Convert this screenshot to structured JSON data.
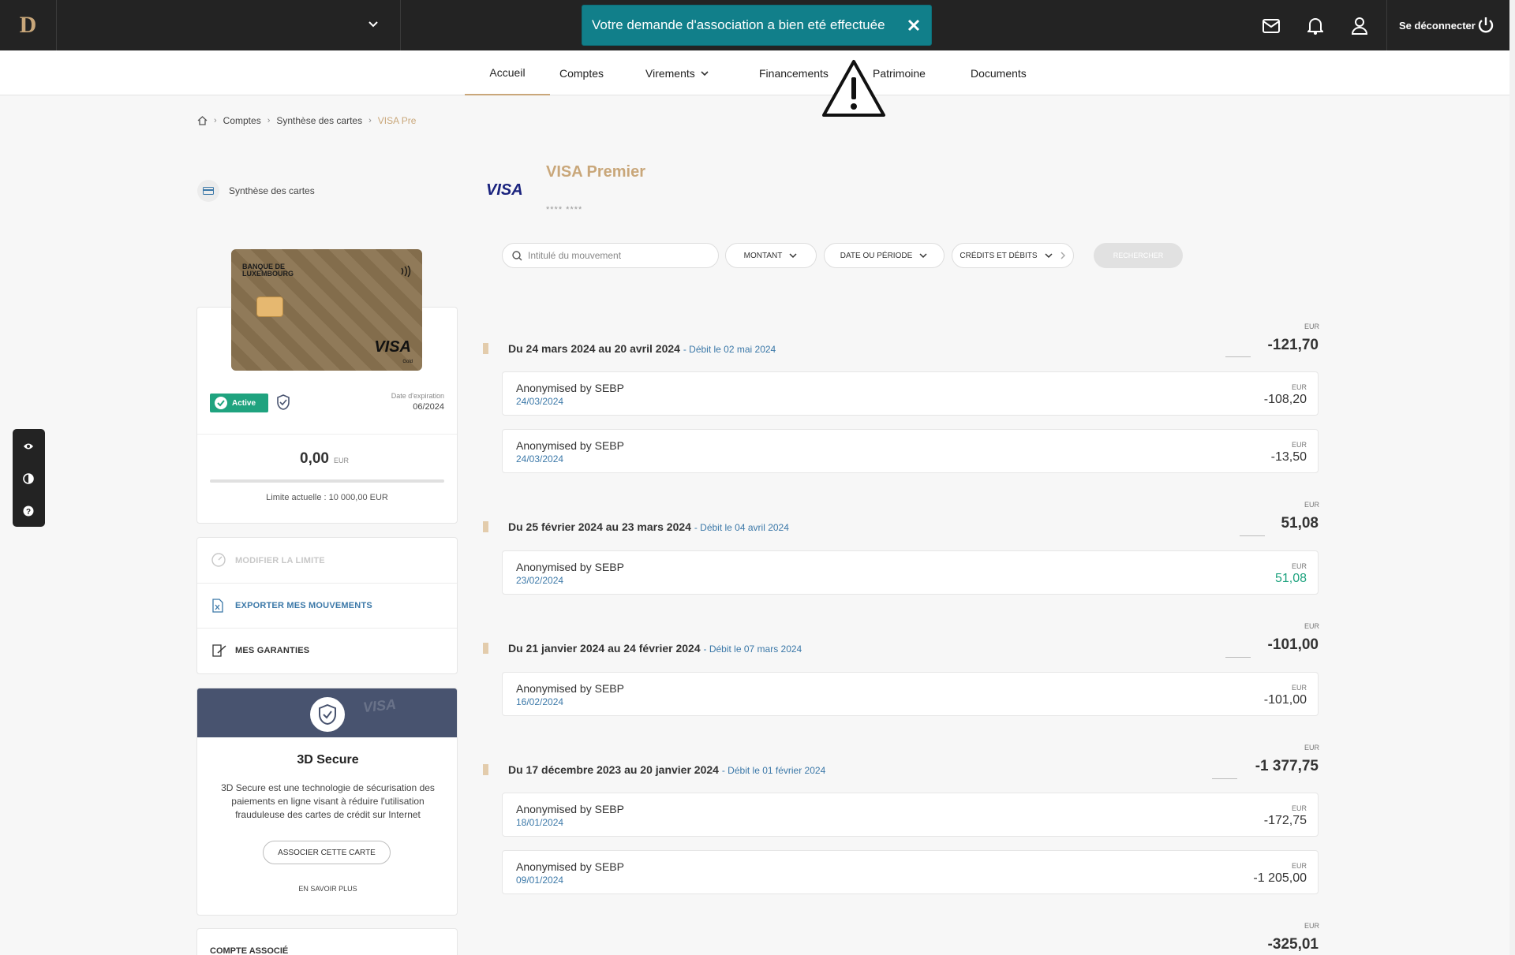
{
  "topbar": {
    "logo": "D",
    "toast": "Votre demande d'association a bien eté effectuée",
    "logout": "Se déconnecter"
  },
  "nav": [
    "Accueil",
    "Comptes",
    "Virements",
    "Financements",
    "Patrimoine",
    "Documents"
  ],
  "breadcrumb": [
    "Comptes",
    "Synthèse des cartes",
    "VISA Pre"
  ],
  "left": {
    "synthese": "Synthèse des cartes",
    "card": {
      "bank": "BANQUE DE LUXEMBOURG",
      "brand": "VISA",
      "tier": "Gold",
      "status": "Active",
      "expiry_label": "Date d'expiration",
      "expiry": "06/2024",
      "balance": "0,00",
      "currency": "EUR",
      "usage_fraction": 0,
      "limit": "Limite actuelle : 10 000,00 EUR"
    },
    "actions": [
      "MODIFIER LA LIMITE",
      "EXPORTER MES MOUVEMENTS",
      "MES GARANTIES"
    ],
    "secure": {
      "band_text": "VISA",
      "title": "3D Secure",
      "desc": "3D Secure est une technologie de sécurisation des paiements en ligne visant à réduire l'utilisation frauduleuse des cartes de crédit sur Internet",
      "assoc": "ASSOCIER CETTE CARTE",
      "more": "EN SAVOIR PLUS"
    },
    "linked_account": "COMPTE ASSOCIÉ"
  },
  "main": {
    "brand": "VISA",
    "title": "VISA Premier",
    "mask": "**** ****",
    "search_placeholder": "Intitulé du mouvement",
    "filters": [
      "MONTANT",
      "DATE OU PÉRIODE",
      "CRÉDITS ET DÉBITS"
    ],
    "search_button": "RECHERCHER",
    "periods": [
      {
        "label": "Du 24 mars 2024 au 20 avril 2024",
        "debit": "- Débit le 02 mai 2024",
        "currency": "EUR",
        "total": "-121,70",
        "transactions": [
          {
            "name": "Anonymised by SEBP",
            "date": "24/03/2024",
            "currency": "EUR",
            "amount": "-108,20"
          },
          {
            "name": "Anonymised by SEBP",
            "date": "24/03/2024",
            "currency": "EUR",
            "amount": "-13,50"
          }
        ]
      },
      {
        "label": "Du 25 février 2024 au 23 mars 2024",
        "debit": "- Débit le 04 avril 2024",
        "currency": "EUR",
        "total": "51,08",
        "transactions": [
          {
            "name": "Anonymised by SEBP",
            "date": "23/02/2024",
            "currency": "EUR",
            "amount": "51,08",
            "positive": true
          }
        ]
      },
      {
        "label": "Du 21 janvier 2024 au 24 février 2024",
        "debit": "- Débit le 07 mars 2024",
        "currency": "EUR",
        "total": "-101,00",
        "transactions": [
          {
            "name": "Anonymised by SEBP",
            "date": "16/02/2024",
            "currency": "EUR",
            "amount": "-101,00"
          }
        ]
      },
      {
        "label": "Du 17 décembre 2023 au 20 janvier 2024",
        "debit": "- Débit le 01 février 2024",
        "currency": "EUR",
        "total": "-1 377,75",
        "transactions": [
          {
            "name": "Anonymised by SEBP",
            "date": "18/01/2024",
            "currency": "EUR",
            "amount": "-172,75"
          },
          {
            "name": "Anonymised by SEBP",
            "date": "09/01/2024",
            "currency": "EUR",
            "amount": "-1 205,00"
          }
        ]
      },
      {
        "currency": "EUR",
        "total": "-325,01",
        "transactions": []
      }
    ]
  },
  "colors": {
    "topbar": "#232323",
    "accent_gold": "#c9a77a",
    "toast": "#117f8a",
    "link_blue": "#3b78a8",
    "positive_green": "#1fa37f"
  }
}
